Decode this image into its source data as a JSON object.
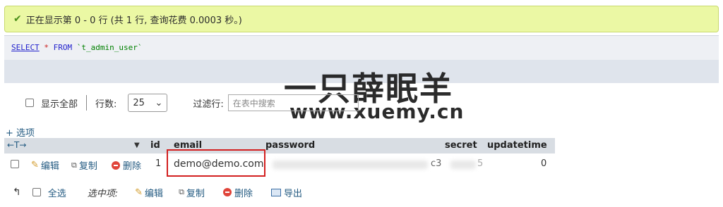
{
  "success": {
    "message": "正在显示第 0 - 0 行 (共 1 行, 查询花费 0.0003 秒。)"
  },
  "sql": {
    "kw1": "SELECT",
    "star": "*",
    "kw2": "FROM",
    "table": "`t_admin_user`"
  },
  "watermark": {
    "line1": "一只薛眠羊",
    "line2": "www.xuemy.cn"
  },
  "controls": {
    "show_all": "显示全部",
    "rows_label": "行数:",
    "rows_value": "25",
    "filter_label": "过滤行:",
    "filter_placeholder": "在表中搜索"
  },
  "options_link": "+ 选项",
  "table": {
    "columns": [
      "id",
      "email",
      "password",
      "secret",
      "updatetime"
    ],
    "rows": [
      {
        "id": "1",
        "email": "demo@demo.com",
        "password_tail": "c3",
        "secret_tail": "5",
        "updatetime": "0"
      }
    ]
  },
  "row_actions": {
    "edit": "编辑",
    "copy": "复制",
    "delete": "删除"
  },
  "footer": {
    "select_all": "全选",
    "with_selected": "选中项:",
    "edit": "编辑",
    "copy": "复制",
    "delete": "删除",
    "export": "导出"
  },
  "colors": {
    "success_bg": "#ebf8a4",
    "link": "#235a81",
    "highlight": "#d32020"
  }
}
